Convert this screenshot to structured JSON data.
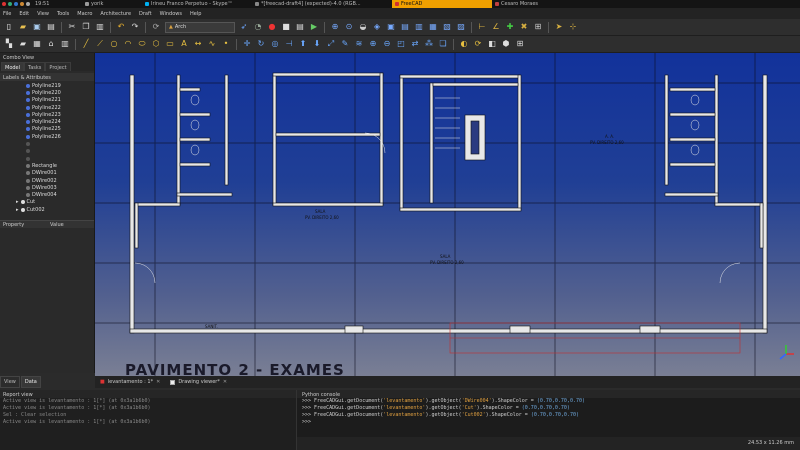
{
  "taskbar": {
    "clock": "19:51",
    "windows": [
      {
        "label": "yorik",
        "color": "#9a9a9a",
        "active": false
      },
      {
        "label": "Irineu Franco Perpetuo - Skype™",
        "color": "#00aff0",
        "active": false
      },
      {
        "label": "*[freecad-draft4] (expected)-4.0 (RGB...",
        "color": "#888888",
        "active": false
      },
      {
        "label": "FreeCAD",
        "color": "#d03030",
        "active": true
      },
      {
        "label": "Cesaro Moraes",
        "color": "#c04040",
        "active": false
      }
    ]
  },
  "menubar": {
    "items": [
      "File",
      "Edit",
      "View",
      "Tools",
      "Macro",
      "Architecture",
      "Draft",
      "Windows",
      "Help"
    ]
  },
  "toolbar": {
    "workbench": "Arch"
  },
  "combo": {
    "title": "Combo View",
    "tabs": [
      "Model",
      "Tasks",
      "Project"
    ],
    "section": "Labels & Attributes",
    "tree": [
      {
        "label": "Polyline219",
        "icon": "#4a6fd8"
      },
      {
        "label": "Polyline220",
        "icon": "#4a6fd8"
      },
      {
        "label": "Polyline221",
        "icon": "#4a6fd8"
      },
      {
        "label": "Polyline222",
        "icon": "#4a6fd8"
      },
      {
        "label": "Polyline223",
        "icon": "#4a6fd8"
      },
      {
        "label": "Polyline224",
        "icon": "#4a6fd8"
      },
      {
        "label": "Polyline225",
        "icon": "#4a6fd8"
      },
      {
        "label": "Polyline226",
        "icon": "#4a6fd8"
      },
      {
        "label": "",
        "icon": "#555555"
      },
      {
        "label": "",
        "icon": "#555555"
      },
      {
        "label": "",
        "icon": "#555555"
      },
      {
        "label": "Rectangle",
        "icon": "#777777"
      },
      {
        "label": "DWire001",
        "icon": "#777777"
      },
      {
        "label": "DWire002",
        "icon": "#777777"
      },
      {
        "label": "DWire003",
        "icon": "#777777"
      },
      {
        "label": "DWire004",
        "icon": "#777777"
      },
      {
        "label": "Cut",
        "icon": "#dddddd"
      },
      {
        "label": "Cut002",
        "icon": "#dddddd"
      }
    ],
    "property_header": [
      "Property",
      "Value"
    ],
    "bottom_tabs": [
      "View",
      "Data"
    ]
  },
  "document_tabs": [
    {
      "label": "levantamento : 1*"
    },
    {
      "label": "Drawing viewer*"
    }
  ],
  "report": {
    "title": "Report view",
    "lines": [
      "Active view is levantamento : 1[*] (at 0x3a1b6b0)",
      "Active view is levantamento : 1[*] (at 0x3a1b6b0)",
      "Sel : Clear selection",
      "Active view is levantamento : 1[*] (at 0x3a1b6b0)"
    ]
  },
  "python": {
    "title": "Python console",
    "lines": [
      {
        "prefix": ">>> FreeCADGui.getDocument(",
        "doc": "'levantamento'",
        "mid": ").getObject(",
        "obj": "'DWire004'",
        "tail": ").ShapeColor = ",
        "val": "(0.70,0.70,0.70)"
      },
      {
        "prefix": ">>> FreeCADGui.getDocument(",
        "doc": "'levantamento'",
        "mid": ").getObject(",
        "obj": "'Cut'",
        "tail": ").ShapeColor = ",
        "val": "(0.70,0.70,0.70)"
      },
      {
        "prefix": ">>> FreeCADGui.getDocument(",
        "doc": "'levantamento'",
        "mid": ").getObject(",
        "obj": "'Cut002'",
        "tail": ").ShapeColor = ",
        "val": "(0.70,0.70,0.70)"
      }
    ],
    "prompt": ">>>"
  },
  "status": {
    "dimensions": "24.53 x 11.26 mm"
  },
  "drawing": {
    "title": "PAVIMENTO 2 - EXAMES",
    "room_labels": [
      "SANIT.",
      "PV. DIREITO 2,60",
      "SALA",
      "PV. DIREITO 2,60",
      "A. A.",
      "PV. DIREITO 2,60"
    ]
  }
}
